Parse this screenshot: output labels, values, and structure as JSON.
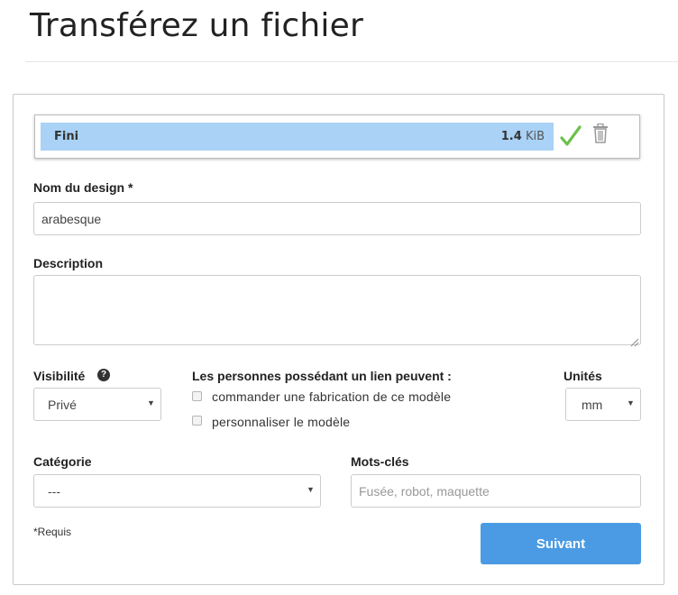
{
  "page": {
    "title": "Transférez un fichier"
  },
  "upload": {
    "status": "Fini",
    "size_value": "1.4",
    "size_unit": "KiB",
    "progress": 1.0,
    "done_icon": "check-icon",
    "delete_icon": "trash-icon",
    "colors": {
      "bar": "#a9d2f6",
      "check": "#6cc04a"
    }
  },
  "form": {
    "name": {
      "label": "Nom du design *",
      "value": "arabesque"
    },
    "description": {
      "label": "Description",
      "value": ""
    },
    "visibility": {
      "label": "Visibilité",
      "help_icon": "question-circle-icon",
      "selected": "Privé"
    },
    "link_permissions": {
      "label": "Les personnes possédant un lien peuvent :",
      "options": [
        {
          "label": "commander une fabrication de ce modèle",
          "checked": false
        },
        {
          "label": "personnaliser le modèle",
          "checked": false
        }
      ]
    },
    "units": {
      "label": "Unités",
      "selected": "mm"
    },
    "category": {
      "label": "Catégorie",
      "selected": "---"
    },
    "keywords": {
      "label": "Mots-clés",
      "placeholder": "Fusée, robot, maquette",
      "value": ""
    },
    "required_note": "*Requis",
    "next_button": "Suivant",
    "colors": {
      "primary": "#4a9be3"
    }
  }
}
